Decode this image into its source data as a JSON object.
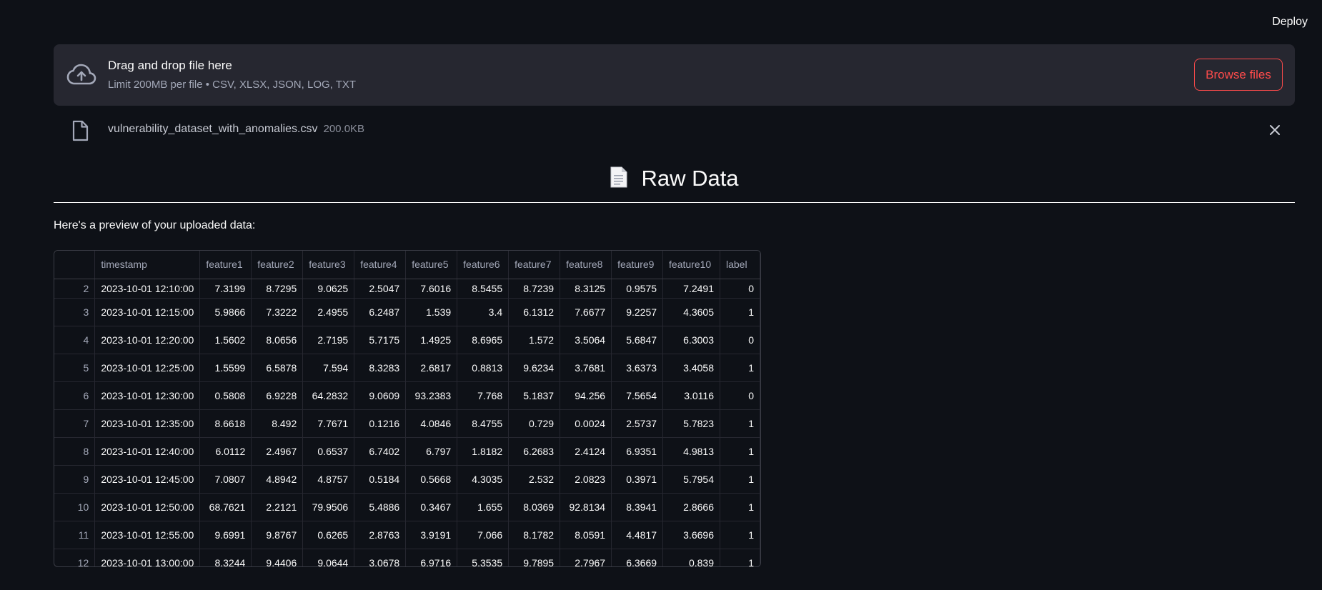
{
  "header": {
    "deploy_label": "Deploy"
  },
  "uploader": {
    "title": "Drag and drop file here",
    "limit": "Limit 200MB per file • CSV, XLSX, JSON, LOG, TXT",
    "browse_label": "Browse files",
    "accent_color": "#ff4b4b",
    "icon": "cloud-upload-icon"
  },
  "file": {
    "name": "vulnerability_dataset_with_anomalies.csv",
    "size": "200.0KB",
    "icon": "file-icon"
  },
  "section": {
    "emoji": "page-icon",
    "title": "Raw Data"
  },
  "preview_text": "Here's a preview of your uploaded data:",
  "table": {
    "columns": [
      "",
      "timestamp",
      "feature1",
      "feature2",
      "feature3",
      "feature4",
      "feature5",
      "feature6",
      "feature7",
      "feature8",
      "feature9",
      "feature10",
      "label"
    ],
    "rows": [
      [
        "2",
        "2023-10-01 12:10:00",
        "7.3199",
        "8.7295",
        "9.0625",
        "2.5047",
        "7.6016",
        "8.5455",
        "8.7239",
        "8.3125",
        "0.9575",
        "7.2491",
        "0"
      ],
      [
        "3",
        "2023-10-01 12:15:00",
        "5.9866",
        "7.3222",
        "2.4955",
        "6.2487",
        "1.539",
        "3.4",
        "6.1312",
        "7.6677",
        "9.2257",
        "4.3605",
        "1"
      ],
      [
        "4",
        "2023-10-01 12:20:00",
        "1.5602",
        "8.0656",
        "2.7195",
        "5.7175",
        "1.4925",
        "8.6965",
        "1.572",
        "3.5064",
        "5.6847",
        "6.3003",
        "0"
      ],
      [
        "5",
        "2023-10-01 12:25:00",
        "1.5599",
        "6.5878",
        "7.594",
        "8.3283",
        "2.6817",
        "0.8813",
        "9.6234",
        "3.7681",
        "3.6373",
        "3.4058",
        "1"
      ],
      [
        "6",
        "2023-10-01 12:30:00",
        "0.5808",
        "6.9228",
        "64.2832",
        "9.0609",
        "93.2383",
        "7.768",
        "5.1837",
        "94.256",
        "7.5654",
        "3.0116",
        "0"
      ],
      [
        "7",
        "2023-10-01 12:35:00",
        "8.6618",
        "8.492",
        "7.7671",
        "0.1216",
        "4.0846",
        "8.4755",
        "0.729",
        "0.0024",
        "2.5737",
        "5.7823",
        "1"
      ],
      [
        "8",
        "2023-10-01 12:40:00",
        "6.0112",
        "2.4967",
        "0.6537",
        "6.7402",
        "6.797",
        "1.8182",
        "6.2683",
        "2.4124",
        "6.9351",
        "4.9813",
        "1"
      ],
      [
        "9",
        "2023-10-01 12:45:00",
        "7.0807",
        "4.8942",
        "4.8757",
        "0.5184",
        "0.5668",
        "4.3035",
        "2.532",
        "2.0823",
        "0.3971",
        "5.7954",
        "1"
      ],
      [
        "10",
        "2023-10-01 12:50:00",
        "68.7621",
        "2.2121",
        "79.9506",
        "5.4886",
        "0.3467",
        "1.655",
        "8.0369",
        "92.8134",
        "8.3941",
        "2.8666",
        "1"
      ],
      [
        "11",
        "2023-10-01 12:55:00",
        "9.6991",
        "9.8767",
        "0.6265",
        "2.8763",
        "3.9191",
        "7.066",
        "8.1782",
        "8.0591",
        "4.4817",
        "3.6696",
        "1"
      ],
      [
        "12",
        "2023-10-01 13:00:00",
        "8.3244",
        "9.4406",
        "9.0644",
        "3.0678",
        "6.9716",
        "5.3535",
        "9.7895",
        "2.7967",
        "6.3669",
        "0.839",
        "1"
      ]
    ]
  }
}
